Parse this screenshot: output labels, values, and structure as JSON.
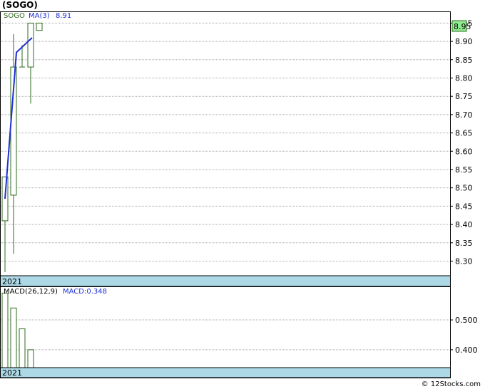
{
  "title": "(SOGO)",
  "footer": "© 12Stocks.com",
  "colors": {
    "candle": "#2e6b1f",
    "ma": "#1f2fd6",
    "macd_bar": "#2e6b1f",
    "year_band": "#add8e6",
    "last_price_box": "#90ee90",
    "grid": "#a9a9a9"
  },
  "chart_data": [
    {
      "type": "candlestick",
      "legend": {
        "symbol": "SOGO",
        "ma_label": "MA(3)",
        "ma_value": "8.91"
      },
      "year_label": "2021",
      "last_price_label": "8.95",
      "y_ticks": [
        "8.95",
        "8.90",
        "8.85",
        "8.80",
        "8.75",
        "8.70",
        "8.65",
        "8.60",
        "8.55",
        "8.50",
        "8.45",
        "8.40",
        "8.35",
        "8.30"
      ],
      "ylim": [
        8.26,
        8.98
      ],
      "candles": [
        {
          "open": 8.41,
          "high": 8.53,
          "low": 8.27,
          "close": 8.53
        },
        {
          "open": 8.48,
          "high": 8.92,
          "low": 8.32,
          "close": 8.83
        },
        {
          "open": 8.83,
          "high": 8.89,
          "low": 8.83,
          "close": 8.83
        },
        {
          "open": 8.83,
          "high": 8.95,
          "low": 8.73,
          "close": 8.95
        },
        {
          "open": 8.95,
          "high": 8.95,
          "low": 8.93,
          "close": 8.93
        }
      ],
      "ma": [
        8.47,
        8.87,
        8.91
      ]
    },
    {
      "type": "bar",
      "legend": {
        "label": "MACD(26,12,9)",
        "value_label": "MACD:0.348"
      },
      "year_label": "2021",
      "y_ticks": [
        "0.500",
        "0.400"
      ],
      "ylim": [
        0.34,
        0.61
      ],
      "values": [
        0.59,
        0.54,
        0.47,
        0.4
      ]
    }
  ]
}
